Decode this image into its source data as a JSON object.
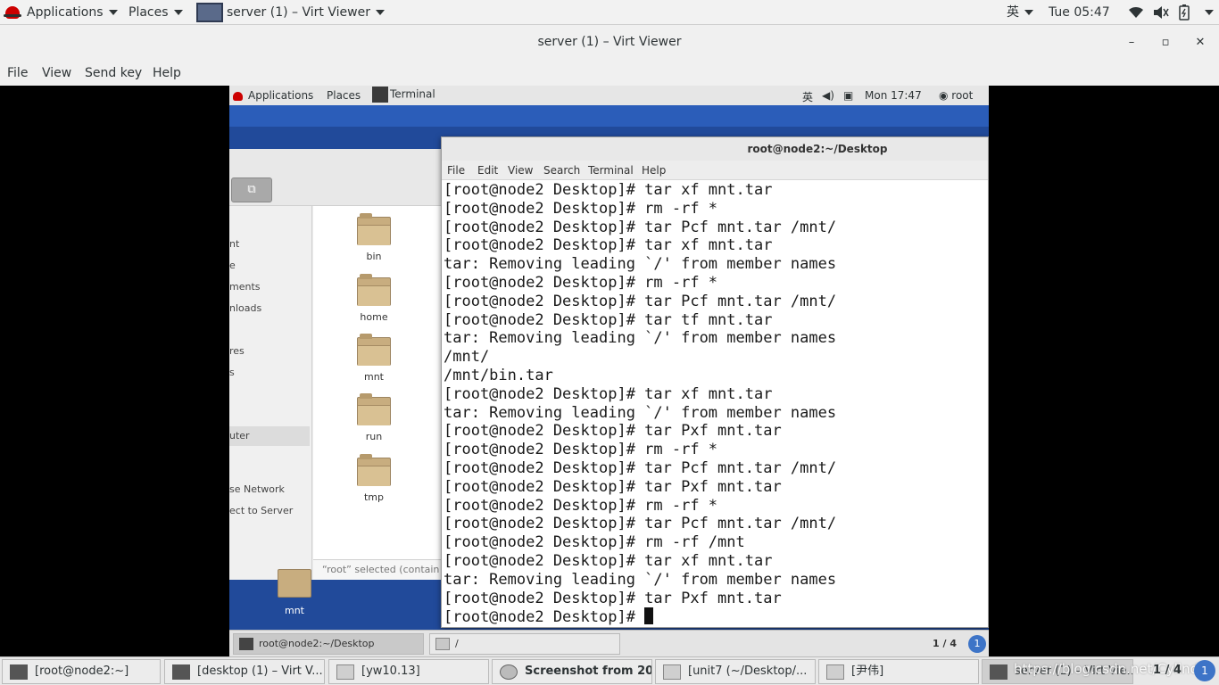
{
  "host_topbar": {
    "applications": "Applications",
    "places": "Places",
    "active_window": "server (1) – Virt Viewer",
    "input_method": "英",
    "clock": "Tue 05:47"
  },
  "window": {
    "title": "server (1) – Virt Viewer",
    "minimize": "–",
    "maximize": "▫",
    "close": "✕",
    "menu": [
      "File",
      "View",
      "Send key",
      "Help"
    ]
  },
  "guest": {
    "topbar": {
      "applications": "Applications",
      "places": "Places",
      "active_window": "Terminal",
      "input_method": "英",
      "clock": "Mon 17:47",
      "user": "root"
    },
    "file_manager": {
      "sidebar": [
        "nt",
        "e",
        "ments",
        "nloads",
        "",
        "res",
        "s",
        "",
        "uter",
        "se Network",
        "ect to Server"
      ],
      "folders": [
        "bin",
        "home",
        "mnt",
        "run",
        "tmp"
      ],
      "status": "“root” selected (contain"
    },
    "desktop_icon": "mnt",
    "terminal": {
      "title": "root@node2:~/Desktop",
      "menu": [
        "File",
        "Edit",
        "View",
        "Search",
        "Terminal",
        "Help"
      ],
      "lines": [
        "[root@node2 Desktop]# tar xf mnt.tar",
        "[root@node2 Desktop]# rm -rf *",
        "[root@node2 Desktop]# tar Pcf mnt.tar /mnt/",
        "[root@node2 Desktop]# tar xf mnt.tar",
        "tar: Removing leading `/' from member names",
        "[root@node2 Desktop]# rm -rf *",
        "[root@node2 Desktop]# tar Pcf mnt.tar /mnt/",
        "[root@node2 Desktop]# tar tf mnt.tar",
        "tar: Removing leading `/' from member names",
        "/mnt/",
        "/mnt/bin.tar",
        "[root@node2 Desktop]# tar xf mnt.tar",
        "tar: Removing leading `/' from member names",
        "[root@node2 Desktop]# tar Pxf mnt.tar",
        "[root@node2 Desktop]# rm -rf *",
        "[root@node2 Desktop]# tar Pcf mnt.tar /mnt/",
        "[root@node2 Desktop]# tar Pxf mnt.tar",
        "[root@node2 Desktop]# rm -rf *",
        "[root@node2 Desktop]# tar Pcf mnt.tar /mnt/",
        "[root@node2 Desktop]# rm -rf /mnt",
        "[root@node2 Desktop]# tar xf mnt.tar",
        "tar: Removing leading `/' from member names",
        "[root@node2 Desktop]# tar Pxf mnt.tar"
      ],
      "prompt": "[root@node2 Desktop]# "
    },
    "taskbar": {
      "tasks": [
        "root@node2:~/Desktop",
        "/"
      ],
      "workspace": "1 / 4",
      "workspace_badge": "1"
    }
  },
  "host_taskbar": {
    "tasks": [
      "[root@node2:~]",
      "[desktop (1) – Virt V...",
      "[yw10.13]",
      "Screenshot from 20...",
      "[unit7 (~/Desktop/...",
      "[尹伟]",
      "server (1) – Virt Vie..."
    ],
    "watermark": "https://blog.csdn.net/Cylinder",
    "workspace": "1 / 4",
    "workspace_badge": "1"
  }
}
